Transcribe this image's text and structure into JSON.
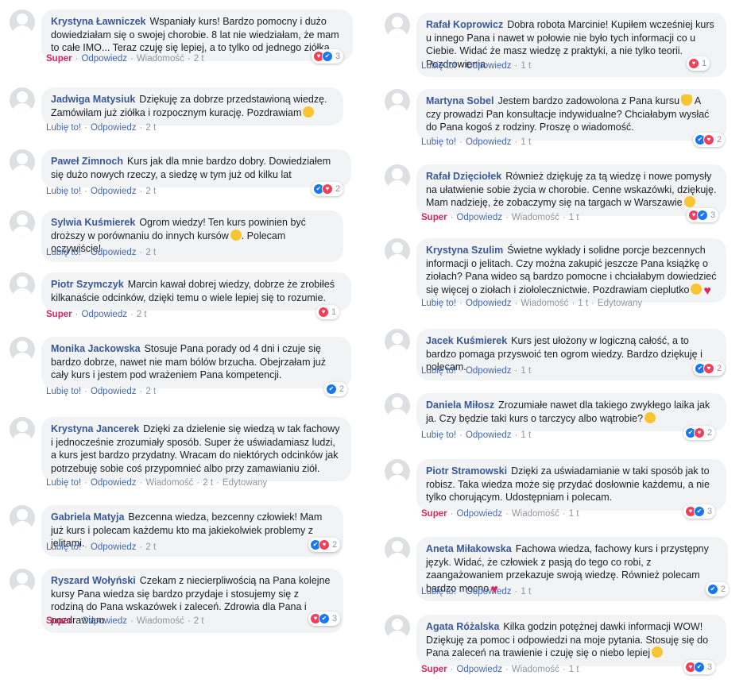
{
  "actions": {
    "like": "Lubię to!",
    "reply": "Odpowiedz",
    "message": "Wiadomość",
    "super": "Super",
    "edited": "Edytowany",
    "sep": "·"
  },
  "colors": {
    "author": "#385898",
    "super": "#e0245e",
    "link": "#4267b2",
    "bubble": "#f2f3f5",
    "love": "#f33e58",
    "like": "#1877f2"
  },
  "left": [
    {
      "author": "Krystyna Ławniczek",
      "text": "Wspaniały kurs! Bardzo pomocny i dużo dowiedziałam się o swojej chorobie. 8 lat nie wiedziałam, że mam to całe IMO... Teraz czuję się lepiej, a to tylko od jednego ziółka",
      "first": "Super",
      "message": "Wiadomość",
      "time": "2 t",
      "reaction_count": "3",
      "reaction_icons": [
        "heart-reaction-icon",
        "like-reaction-icon"
      ]
    },
    {
      "author": "Jadwiga Matysiuk",
      "text": "Dziękuję za dobrze przedstawioną wiedzę. Zamówiłam już ziółka i rozpocznym kurację. Pozdrawiam",
      "emoji": "smile-emoji",
      "first": "Lubię to!",
      "time": "2 t"
    },
    {
      "author": "Paweł Zimnoch",
      "text": "Kurs jak dla mnie bardzo dobry. Dowiedziałem się dużo nowych rzeczy, a siedzę w tym już od kilku lat",
      "first": "Lubię to!",
      "time": "2 t",
      "reaction_count": "2",
      "reaction_icons": [
        "like-reaction-icon",
        "heart-reaction-icon"
      ]
    },
    {
      "author": "Sylwia Kuśmierek",
      "text": "Ogrom wiedzy! Ten kurs powinien być droższy w porównaniu do innych kursów",
      "text2": ".  Polecam oczywiście!",
      "emoji": "laugh-emoji",
      "first": "Lubię to!",
      "time": "2 t"
    },
    {
      "author": "Piotr Szymczyk",
      "text": "Marcin kawał dobrej wiedzy, dobrze że zrobiłeś kilkanaście odcinków, dzięki temu o wiele lepiej się to rozumie.",
      "first": "Super",
      "time": "2 t",
      "reaction_count": "1",
      "reaction_icons": [
        "heart-reaction-icon"
      ]
    },
    {
      "author": "Monika Jackowska",
      "text": "Stosuje Pana porady od 4 dni i czuje się bardzo dobrze, nawet nie mam bólów brzucha. Obejrzałam już cały kurs i jestem pod wrażeniem Pana kompetencji.",
      "first": "Lubię to!",
      "time": "2 t",
      "reaction_count": "2",
      "reaction_icons": [
        "like-reaction-icon"
      ]
    },
    {
      "author": "Krystyna Jancerek",
      "text": "Dzięki za dzielenie się wiedzą w tak fachowy i jednocześnie zrozumiały sposób. Super że uświadamiasz ludzi, a kurs jest bardzo przydatny. Wracam do niektórych odcinków jak potrzebuję sobie coś przypomnieć albo przy zamawianiu ziół.",
      "first": "Lubię to!",
      "message": "Wiadomość",
      "time": "2 t",
      "edited": "Edytowany"
    },
    {
      "author": "Gabriela Matyja",
      "text": "Bezcenna wiedza, bezcenny człowiek! Mam już kurs i polecam każdemu kto ma jakiekolwiek problemy z jelitami.",
      "first": "Lubię to!",
      "time": "2 t",
      "reaction_count": "2",
      "reaction_icons": [
        "like-reaction-icon",
        "heart-reaction-icon"
      ]
    },
    {
      "author": "Ryszard Wołyński",
      "text": "Czekam z niecierpliwością na Pana kolejne kursy Pana wiedza się bardzo przydaje i stosujemy się z rodziną do Pana wskazówek i zaleceń. Zdrowia dla Pana i pozdrawiam.",
      "first": "Super",
      "message": "Wiadomość",
      "time": "2 t",
      "reaction_count": "3",
      "reaction_icons": [
        "heart-reaction-icon",
        "like-reaction-icon"
      ]
    }
  ],
  "right": [
    {
      "author": "Rafał Koprowicz",
      "text": "Dobra robota Marcinie! Kupiłem wcześniej kurs u innego Pana i nawet w połowie nie było tych informacji co u Ciebie. Widać że masz wiedzę z praktyki, a nie tylko teorii. Pozdrowienia",
      "first": "Lubię to!",
      "time": "1 t",
      "reaction_count": "1",
      "reaction_icons": [
        "heart-reaction-icon"
      ]
    },
    {
      "author": "Martyna Sobel",
      "text": "Jestem bardzo zadowolona z Pana kursu",
      "text2": " A czy prowadzi Pan konsultacje indywidualne? Chciałabym wysłać do Pana kogoś z rodziny. Proszę o wiadomość.",
      "emoji": "clap-emoji",
      "first": "Lubię to!",
      "time": "1 t",
      "reaction_count": "2",
      "reaction_icons": [
        "like-reaction-icon",
        "heart-reaction-icon"
      ]
    },
    {
      "author": "Rafał Dzięciołek",
      "text": "Również dziękuję za tą wiedzę i nowe pomysły na ułatwienie sobie życia w chorobie. Cenne wskazówki, dziękuję. Mam nadzieję, że zobaczymy się na targach w Warszawie",
      "emoji": "smile-emoji",
      "first": "Super",
      "message": "Wiadomość",
      "time": "1 t",
      "reaction_count": "3",
      "reaction_icons": [
        "heart-reaction-icon",
        "like-reaction-icon"
      ]
    },
    {
      "author": "Krystyna Szulim",
      "text": "Świetne wykłady i solidne porcje bezcennych informacji o jelitach. Czy można zakupić jeszcze Pana książkę o ziołach? Pana wideo są bardzo pomocne i chciałabym dowiedzieć się więcej o ziołach i ziołolecznictwie. Pozdrawiam cieplutko",
      "emoji": "smile-emoji",
      "emoji2": "heart-emoji",
      "first": "Lubię to!",
      "message": "Wiadomość",
      "time": "1 t",
      "edited": "Edytowany"
    },
    {
      "author": "Jacek Kuśmierek",
      "text": "Kurs jest ułożony w logiczną całość, a to bardzo pomaga przyswoić ten ogrom wiedzy. Bardzo dziękuję i polecam.",
      "first": "Lubię to!",
      "time": "1 t",
      "reaction_count": "2",
      "reaction_icons": [
        "like-reaction-icon",
        "heart-reaction-icon"
      ]
    },
    {
      "author": "Daniela Miłosz",
      "text": "Zrozumiałe nawet dla takiego zwykłego laika jak ja. Czy będzie taki kurs o tarczycy albo wątrobie?",
      "emoji": "smile-emoji",
      "first": "Lubię to!",
      "time": "1 t",
      "reaction_count": "2",
      "reaction_icons": [
        "like-reaction-icon",
        "heart-reaction-icon"
      ]
    },
    {
      "author": "Piotr Stramowski",
      "text": "Dzięki za uświadamianie w taki sposób jak to robisz. Taka wiedza może się przydać dosłownie każdemu, a nie tylko chorującym. Udostępniam i polecam.",
      "first": "Super",
      "message": "Wiadomość",
      "time": "1 t",
      "reaction_count": "3",
      "reaction_icons": [
        "heart-reaction-icon",
        "like-reaction-icon"
      ]
    },
    {
      "author": "Aneta Miłakowska",
      "text": "Fachowa wiedza, fachowy kurs i przystępny język. Widać, że człowiek z pasją do tego co robi, z zaangażowaniem przekazuje swoją wiedzę. Również polecam bardzo mocno",
      "emoji": "heart-emoji",
      "first": "Lubię to!",
      "time": "1 t",
      "reaction_count": "2",
      "reaction_icons": [
        "like-reaction-icon"
      ]
    },
    {
      "author": "Agata Różalska",
      "text": "Kilka godzin potężnej dawki informacji WOW! Dziękuję za pomoc i odpowiedzi na moje pytania. Stosuję się do Pana zaleceń na trawienie i czuję się o niebo lepiej",
      "emoji": "smile-emoji",
      "first": "Super",
      "message": "Wiadomość",
      "time": "1 t",
      "reaction_count": "3",
      "reaction_icons": [
        "heart-reaction-icon",
        "like-reaction-icon"
      ]
    }
  ]
}
